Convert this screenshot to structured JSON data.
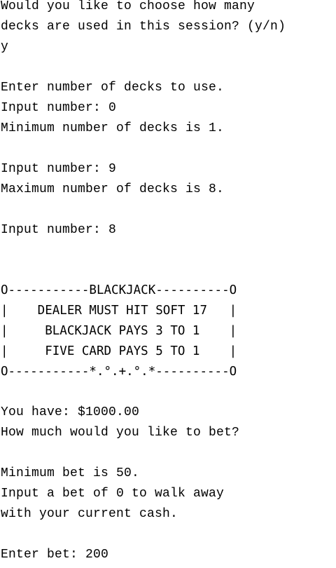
{
  "terminal": {
    "lines": [
      "Would you like to choose how many",
      "decks are used in this session? (y/n)",
      "y",
      "",
      "Enter number of decks to use.",
      "Input number: 0",
      "Minimum number of decks is 1.",
      "",
      "Input number: 9",
      "Maximum number of decks is 8.",
      "",
      "Input number: 8",
      "",
      "",
      "O-----------BLACKJACK----------O",
      "|    DEALER MUST HIT SOFT 17   |",
      "|     BLACKJACK PAYS 3 TO 1    |",
      "|     FIVE CARD PAYS 5 TO 1    |",
      "O-----------*.°.+.°.*----------O",
      "",
      "You have: $1000.00",
      "How much would you like to bet?",
      "",
      "Minimum bet is 50.",
      "Input a bet of 0 to walk away",
      "with your current cash.",
      "",
      "Enter bet: 200"
    ]
  }
}
